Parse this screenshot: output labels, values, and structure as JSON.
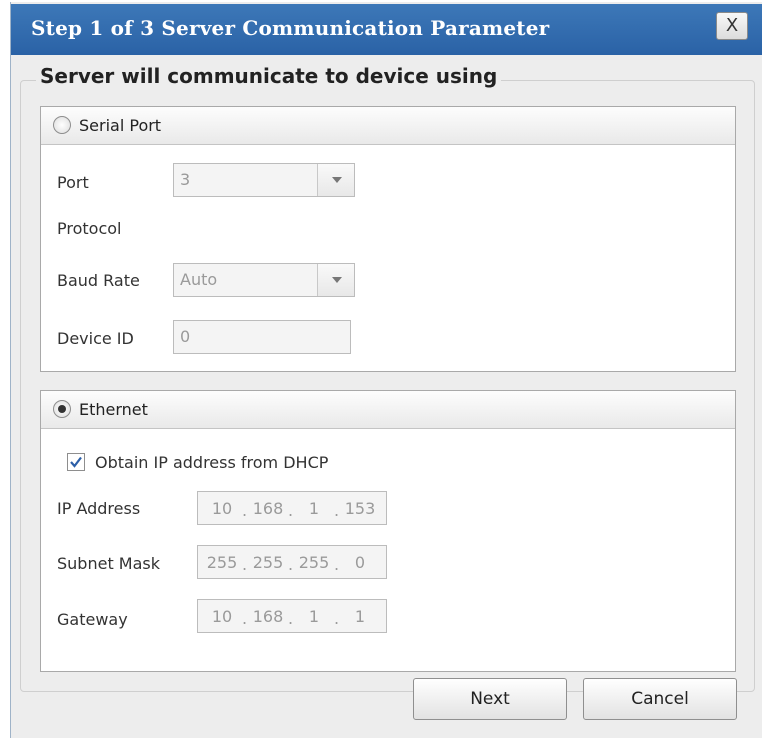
{
  "dialog": {
    "title": "Step 1 of 3 Server Communication Parameter",
    "close_label": "X",
    "group_title": "Server will communicate to device using"
  },
  "serial": {
    "label": "Serial Port",
    "selected": false,
    "port_label": "Port",
    "port_value": "3",
    "protocol_label": "Protocol",
    "baud_label": "Baud Rate",
    "baud_value": "Auto",
    "device_id_label": "Device ID",
    "device_id_value": "0"
  },
  "ethernet": {
    "label": "Ethernet",
    "selected": true,
    "dhcp_label": "Obtain IP address from DHCP",
    "dhcp_checked": true,
    "ip_label": "IP Address",
    "ip": [
      "10",
      "168",
      "1",
      "153"
    ],
    "subnet_label": "Subnet Mask",
    "subnet": [
      "255",
      "255",
      "255",
      "0"
    ],
    "gateway_label": "Gateway",
    "gateway": [
      "10",
      "168",
      "1",
      "1"
    ],
    "separator": "."
  },
  "buttons": {
    "next": "Next",
    "cancel": "Cancel"
  }
}
